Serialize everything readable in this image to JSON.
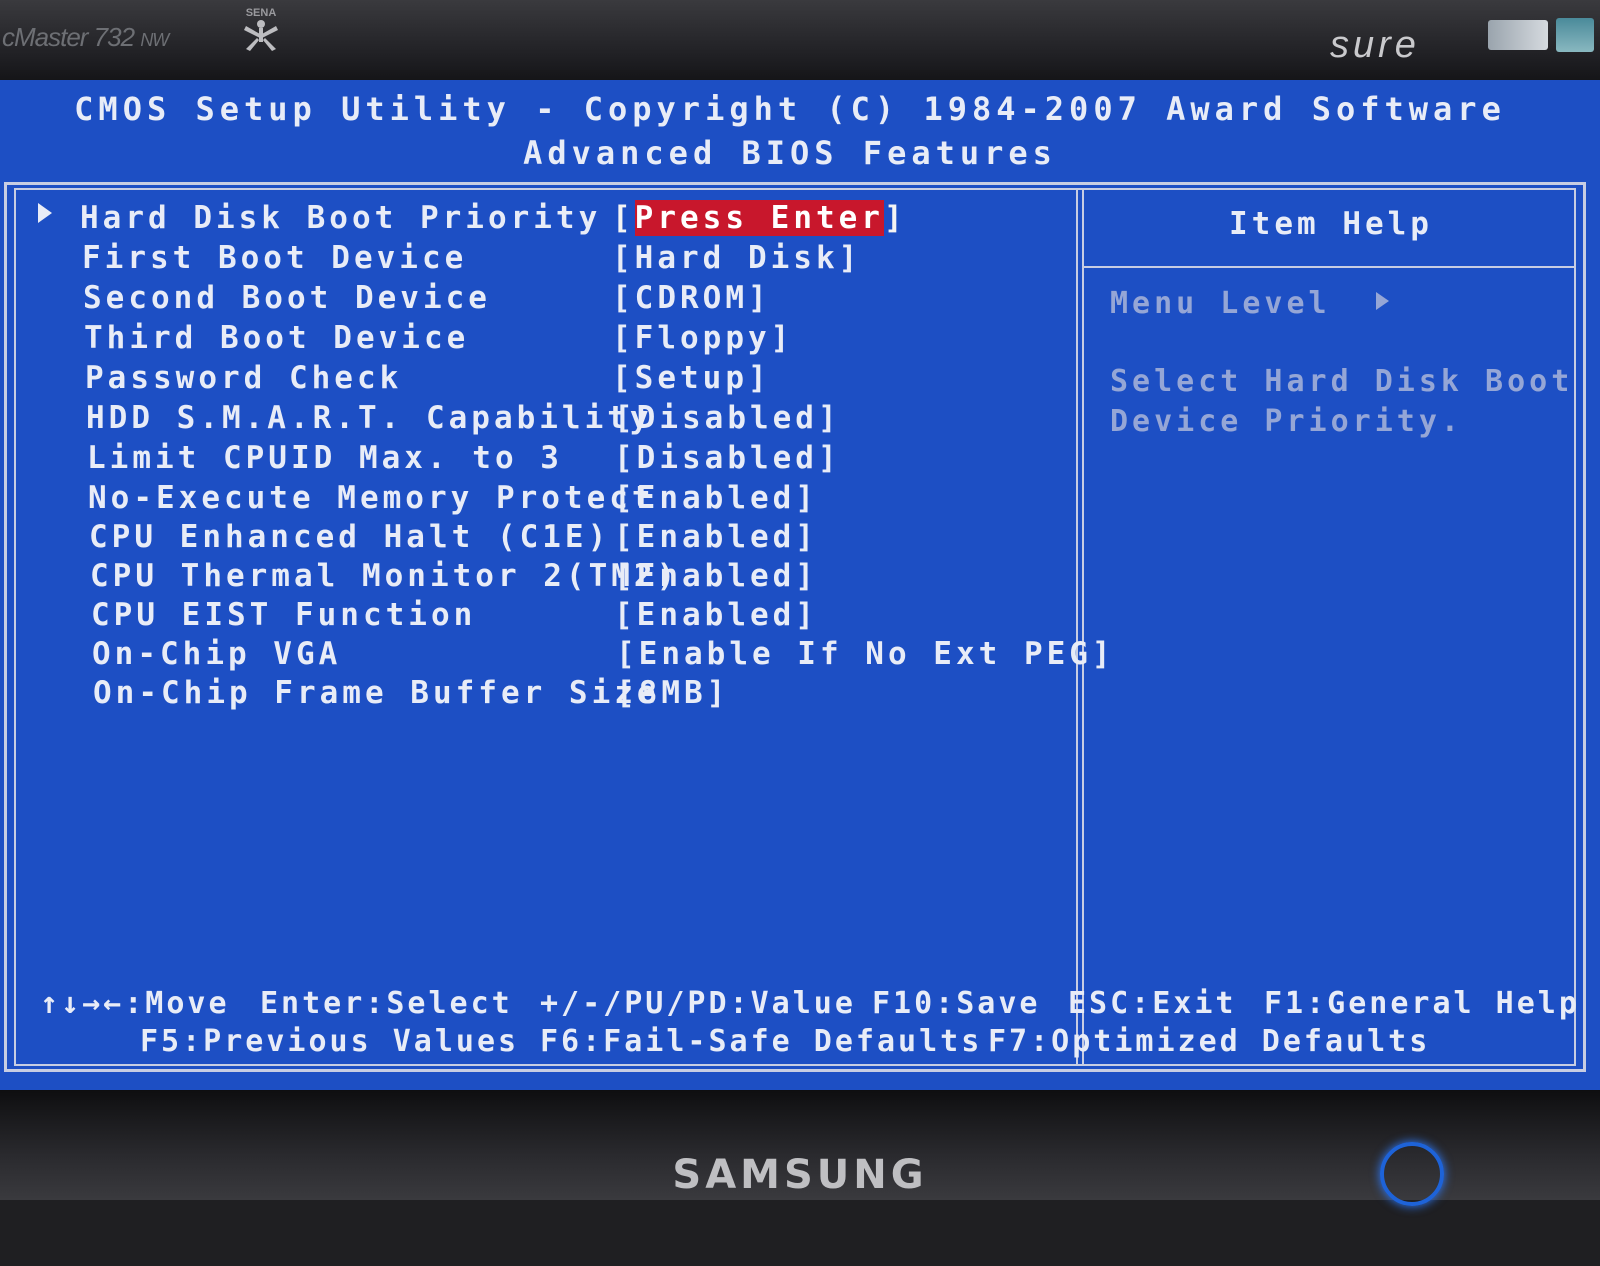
{
  "bezel": {
    "model": "cMaster 732",
    "model_suffix": "NW",
    "badge": "SENA",
    "sure_logo": "sure",
    "brand": "SAMSUNG"
  },
  "header": {
    "title": "CMOS Setup Utility - Copyright (C) 1984-2007 Award Software",
    "subtitle": "Advanced BIOS Features"
  },
  "settings": [
    {
      "label": "Hard Disk Boot Priority",
      "value_open": "[",
      "value": "Press Enter",
      "value_close": "]",
      "submenu": true,
      "selected": true
    },
    {
      "label": "First Boot Device",
      "value": "[Hard Disk]"
    },
    {
      "label": "Second Boot Device",
      "value": "[CDROM]"
    },
    {
      "label": "Third Boot Device",
      "value": "[Floppy]"
    },
    {
      "label": "Password Check",
      "value": "[Setup]"
    },
    {
      "label": "HDD S.M.A.R.T. Capability",
      "value": "[Disabled]"
    },
    {
      "label": "Limit CPUID Max. to 3",
      "value": "[Disabled]"
    },
    {
      "label": "No-Execute Memory Protect",
      "value": "[Enabled]"
    },
    {
      "label": "CPU Enhanced Halt (C1E)",
      "value": "[Enabled]"
    },
    {
      "label": "CPU Thermal Monitor 2(TM2)",
      "value": "[Enabled]"
    },
    {
      "label": "CPU EIST Function",
      "value": "[Enabled]"
    },
    {
      "label": "On-Chip VGA",
      "value": "[Enable If No Ext PEG]"
    },
    {
      "label": "On-Chip Frame Buffer Size",
      "value": "[8MB]"
    }
  ],
  "help": {
    "title": "Item Help",
    "menu_level": "Menu Level",
    "description_line1": "Select Hard Disk Boot",
    "description_line2": "Device Priority."
  },
  "footer": {
    "move": "↑↓→←:Move",
    "enter": "Enter:Select",
    "value": "+/-/PU/PD:Value",
    "save": "F10:Save",
    "exit": "ESC:Exit",
    "help": "F1:General Help",
    "previous": "F5:Previous Values",
    "failsafe": "F6:Fail-Safe Defaults",
    "optimized": "F7:Optimized Defaults"
  },
  "colors": {
    "screen_bg": "#1d4fc4",
    "text": "#e8ecf7",
    "help_text": "#95a6d6",
    "highlight": "#c8172c",
    "frame": "#c7cde3"
  }
}
